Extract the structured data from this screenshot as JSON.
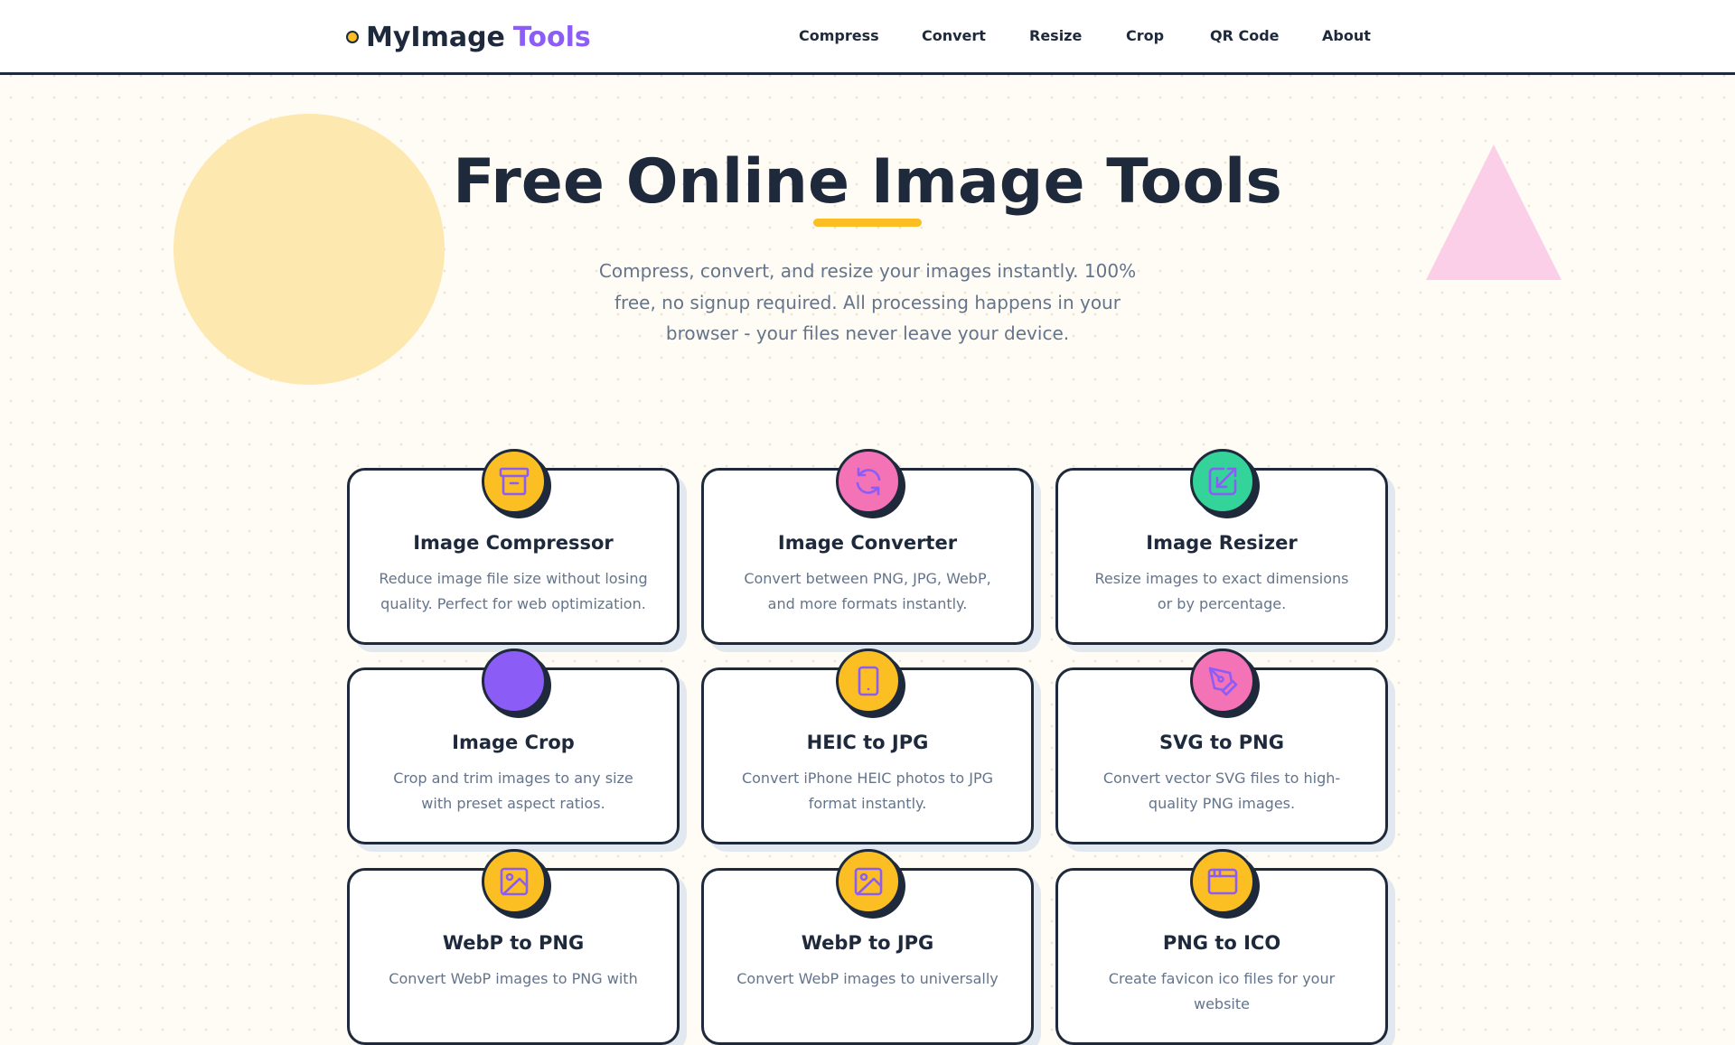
{
  "header": {
    "logo_main": "MyImage",
    "logo_accent": "Tools",
    "nav": [
      "Compress",
      "Convert",
      "Resize",
      "Crop",
      "QR Code",
      "About"
    ]
  },
  "hero": {
    "title": "Free Online Image Tools",
    "subtitle": "Compress, convert, and resize your images instantly. 100% free, no signup required. All processing happens in your browser - your files never leave your device."
  },
  "tools": [
    {
      "title": "Image Compressor",
      "desc": "Reduce image file size without losing quality. Perfect for web optimization.",
      "color": "#fbbf24",
      "icon": "archive-icon"
    },
    {
      "title": "Image Converter",
      "desc": "Convert between PNG, JPG, WebP, and more formats instantly.",
      "color": "#f472b6",
      "icon": "refresh-icon"
    },
    {
      "title": "Image Resizer",
      "desc": "Resize images to exact dimensions or by percentage.",
      "color": "#34d399",
      "icon": "resize-arrow-icon"
    },
    {
      "title": "Image Crop",
      "desc": "Crop and trim images to any size with preset aspect ratios.",
      "color": "#8b5cf6",
      "icon": "crop-icon"
    },
    {
      "title": "HEIC to JPG",
      "desc": "Convert iPhone HEIC photos to JPG format instantly.",
      "color": "#fbbf24",
      "icon": "phone-icon"
    },
    {
      "title": "SVG to PNG",
      "desc": "Convert vector SVG files to high-quality PNG images.",
      "color": "#f472b6",
      "icon": "pen-tool-icon"
    },
    {
      "title": "WebP to PNG",
      "desc": "Convert WebP images to PNG with",
      "color": "#fbbf24",
      "icon": "image-icon"
    },
    {
      "title": "WebP to JPG",
      "desc": "Convert WebP images to universally",
      "color": "#fbbf24",
      "icon": "image-icon"
    },
    {
      "title": "PNG to ICO",
      "desc": "Create favicon ico files for your website",
      "color": "#fbbf24",
      "icon": "browser-window-icon"
    }
  ]
}
